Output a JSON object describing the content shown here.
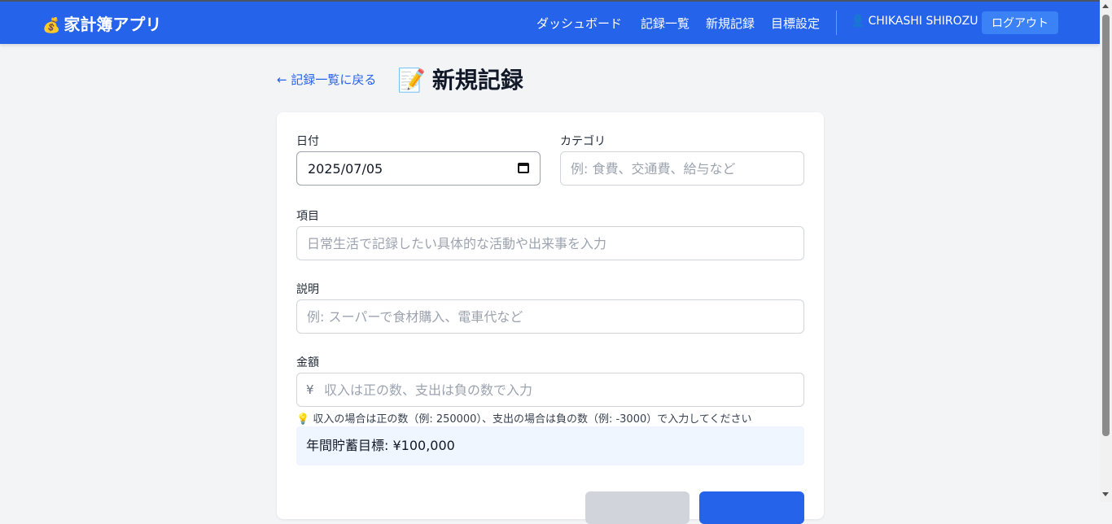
{
  "header": {
    "brand_icon": "💰",
    "brand": "家計簿アプリ",
    "nav": [
      "ダッシュボード",
      "記録一覧",
      "新規記録",
      "目標設定"
    ],
    "user_icon": "👤",
    "user": "CHIKASHI SHIROZU",
    "logout": "ログアウト",
    "bg_color": "#2563eb"
  },
  "page": {
    "back_link": "← 記録一覧に戻る",
    "title_icon": "📝",
    "title": "新規記録"
  },
  "form": {
    "date_label": "日付",
    "date_value": "2025/07/05",
    "category_label": "カテゴリ",
    "category_placeholder": "例: 食費、交通費、給与など",
    "item_label": "項目",
    "item_placeholder": "日常生活で記録したい具体的な活動や出来事を入力",
    "desc_label": "説明",
    "desc_placeholder": "例: スーパーで食材購入、電車代など",
    "amount_label": "金額",
    "amount_prefix": "¥",
    "amount_placeholder": "収入は正の数、支出は負の数で入力",
    "hint": "💡 収入の場合は正の数（例: 250000）、支出の場合は負の数（例: -3000）で入力してください",
    "goal": "年間貯蓄目標: ¥100,000"
  }
}
